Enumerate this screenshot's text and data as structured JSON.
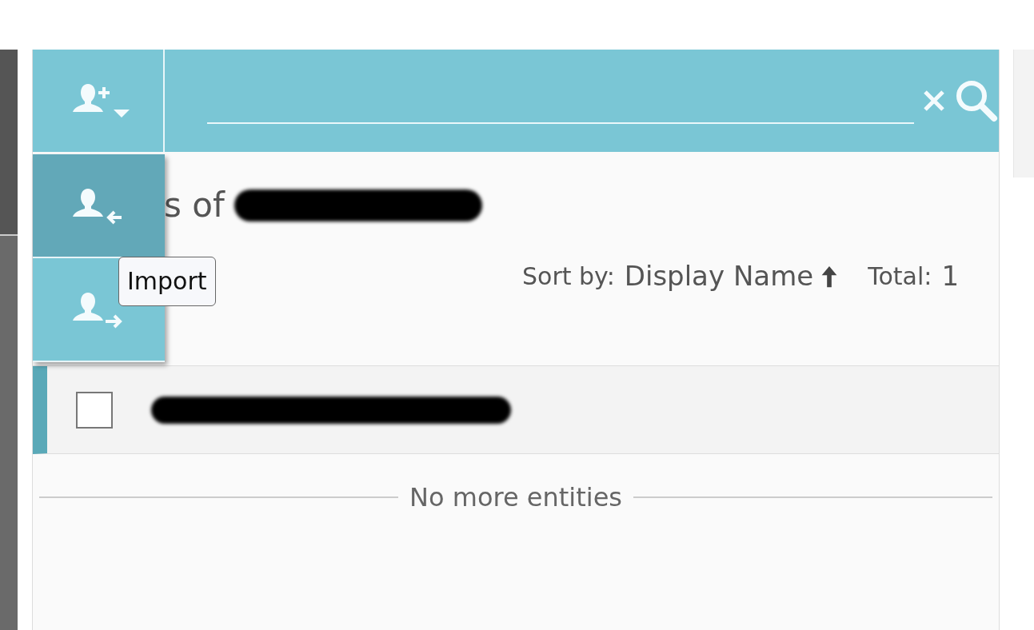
{
  "toolbar": {
    "add_button": {
      "expanded": true
    }
  },
  "menu": [
    {
      "kind": "import",
      "selected": true
    },
    {
      "kind": "export",
      "selected": false
    }
  ],
  "tooltip": "Import",
  "heading": "s of",
  "sort": {
    "label": "Sort by:",
    "field": "Display Name",
    "ascending": true
  },
  "total": {
    "label": "Total:",
    "value": "1"
  },
  "rows": [
    {
      "checked": false
    }
  ],
  "footer": "No more entities"
}
